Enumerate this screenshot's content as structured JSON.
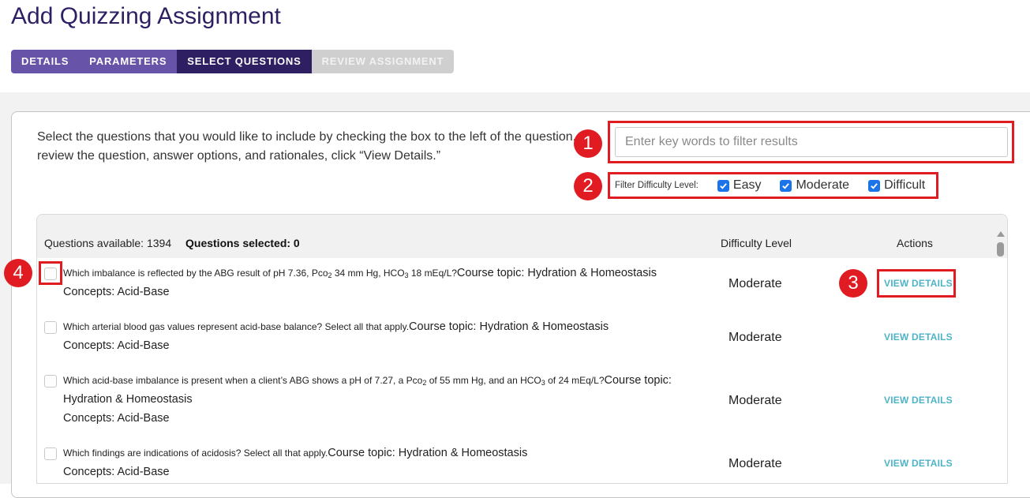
{
  "page": {
    "title": "Add Quizzing Assignment",
    "steps": [
      {
        "label": "DETAILS",
        "state": "done"
      },
      {
        "label": "PARAMETERS",
        "state": "done"
      },
      {
        "label": "SELECT QUESTIONS",
        "state": "active"
      },
      {
        "label": "REVIEW ASSIGNMENT",
        "state": "todo"
      }
    ]
  },
  "instructions": {
    "line1": "Select the questions that you would like to include by checking the box to the left of the question. To",
    "line2": "review the question, answer options, and rationales, click “View Details.”"
  },
  "search": {
    "placeholder": "Enter key words to filter results",
    "value": ""
  },
  "filter": {
    "label": "Filter Difficulty Level:",
    "options": [
      {
        "label": "Easy",
        "checked": true
      },
      {
        "label": "Moderate",
        "checked": true
      },
      {
        "label": "Difficult",
        "checked": true
      }
    ]
  },
  "table": {
    "available_label": "Questions available: 1394",
    "selected_label": "Questions selected: 0",
    "col_difficulty": "Difficulty Level",
    "col_actions": "Actions",
    "rows": [
      {
        "q_a": "Which imbalance is reflected by the ABG result of pH 7.36, Pco",
        "q_sub1": "2",
        "q_b": " 34 mm Hg, HCO",
        "q_sub2": "3",
        "q_c": " 18 mEq/L?",
        "topic": "Course topic: Hydration & Homeostasis",
        "concept": "Concepts: Acid-Base",
        "difficulty": "Moderate",
        "action": "VIEW DETAILS",
        "checked": false
      },
      {
        "q_a": "Which arterial blood gas values represent acid-base balance? Select all that apply.",
        "topic": "Course topic: Hydration & Homeostasis",
        "concept": "Concepts: Acid-Base",
        "difficulty": "Moderate",
        "action": "VIEW DETAILS",
        "checked": false
      },
      {
        "q_a": "Which acid-base imbalance is present when a client’s ABG shows a pH of 7.27, a Pco",
        "q_sub1": "2",
        "q_b": " of 55 mm Hg, and an HCO",
        "q_sub2": "3",
        "q_c": " of 24 mEq/L?",
        "topic": "Course topic:",
        "topic_cont": "Hydration & Homeostasis",
        "concept": "Concepts: Acid-Base",
        "difficulty": "Moderate",
        "action": "VIEW DETAILS",
        "checked": false
      },
      {
        "q_a": "Which findings are indications of acidosis? Select all that apply.",
        "topic": "Course topic: Hydration & Homeostasis",
        "concept": "Concepts: Acid-Base",
        "difficulty": "Moderate",
        "action": "VIEW DETAILS",
        "checked": false
      }
    ]
  },
  "annotations": [
    "1",
    "2",
    "3",
    "4"
  ],
  "colors": {
    "brand_dark": "#2e1f63",
    "step_done": "#6753a8",
    "step_todo": "#cfcfcf",
    "annotation_red": "#e01b22",
    "link": "#4fb3c8",
    "checkbox_blue": "#1a73e8"
  }
}
